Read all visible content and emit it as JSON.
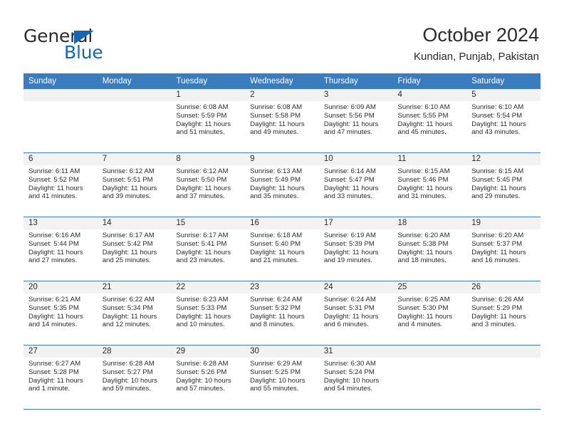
{
  "brand": {
    "name_top": "General",
    "name_bottom": "Blue"
  },
  "header": {
    "title": "October 2024",
    "subtitle": "Kundian, Punjab, Pakistan"
  },
  "weekday_headers": [
    "Sunday",
    "Monday",
    "Tuesday",
    "Wednesday",
    "Thursday",
    "Friday",
    "Saturday"
  ],
  "colors": {
    "header_blue": "#3b7cbe",
    "logo_blue": "#1565b0",
    "daynum_band": "#f2f2f2",
    "text": "#2b2b2b"
  },
  "labels": {
    "sunrise_prefix": "Sunrise: ",
    "sunset_prefix": "Sunset: ",
    "daylight_prefix": "Daylight: "
  },
  "weeks": [
    [
      {
        "day": "",
        "sunrise": "",
        "sunset": "",
        "daylight_line1": "",
        "daylight_line2": "",
        "blank": true
      },
      {
        "day": "",
        "sunrise": "",
        "sunset": "",
        "daylight_line1": "",
        "daylight_line2": "",
        "blank": true
      },
      {
        "day": "1",
        "sunrise": "Sunrise: 6:08 AM",
        "sunset": "Sunset: 5:59 PM",
        "daylight_line1": "Daylight: 11 hours",
        "daylight_line2": "and 51 minutes."
      },
      {
        "day": "2",
        "sunrise": "Sunrise: 6:08 AM",
        "sunset": "Sunset: 5:58 PM",
        "daylight_line1": "Daylight: 11 hours",
        "daylight_line2": "and 49 minutes."
      },
      {
        "day": "3",
        "sunrise": "Sunrise: 6:09 AM",
        "sunset": "Sunset: 5:56 PM",
        "daylight_line1": "Daylight: 11 hours",
        "daylight_line2": "and 47 minutes."
      },
      {
        "day": "4",
        "sunrise": "Sunrise: 6:10 AM",
        "sunset": "Sunset: 5:55 PM",
        "daylight_line1": "Daylight: 11 hours",
        "daylight_line2": "and 45 minutes."
      },
      {
        "day": "5",
        "sunrise": "Sunrise: 6:10 AM",
        "sunset": "Sunset: 5:54 PM",
        "daylight_line1": "Daylight: 11 hours",
        "daylight_line2": "and 43 minutes."
      }
    ],
    [
      {
        "day": "6",
        "sunrise": "Sunrise: 6:11 AM",
        "sunset": "Sunset: 5:52 PM",
        "daylight_line1": "Daylight: 11 hours",
        "daylight_line2": "and 41 minutes."
      },
      {
        "day": "7",
        "sunrise": "Sunrise: 6:12 AM",
        "sunset": "Sunset: 5:51 PM",
        "daylight_line1": "Daylight: 11 hours",
        "daylight_line2": "and 39 minutes."
      },
      {
        "day": "8",
        "sunrise": "Sunrise: 6:12 AM",
        "sunset": "Sunset: 5:50 PM",
        "daylight_line1": "Daylight: 11 hours",
        "daylight_line2": "and 37 minutes."
      },
      {
        "day": "9",
        "sunrise": "Sunrise: 6:13 AM",
        "sunset": "Sunset: 5:49 PM",
        "daylight_line1": "Daylight: 11 hours",
        "daylight_line2": "and 35 minutes."
      },
      {
        "day": "10",
        "sunrise": "Sunrise: 6:14 AM",
        "sunset": "Sunset: 5:47 PM",
        "daylight_line1": "Daylight: 11 hours",
        "daylight_line2": "and 33 minutes."
      },
      {
        "day": "11",
        "sunrise": "Sunrise: 6:15 AM",
        "sunset": "Sunset: 5:46 PM",
        "daylight_line1": "Daylight: 11 hours",
        "daylight_line2": "and 31 minutes."
      },
      {
        "day": "12",
        "sunrise": "Sunrise: 6:15 AM",
        "sunset": "Sunset: 5:45 PM",
        "daylight_line1": "Daylight: 11 hours",
        "daylight_line2": "and 29 minutes."
      }
    ],
    [
      {
        "day": "13",
        "sunrise": "Sunrise: 6:16 AM",
        "sunset": "Sunset: 5:44 PM",
        "daylight_line1": "Daylight: 11 hours",
        "daylight_line2": "and 27 minutes."
      },
      {
        "day": "14",
        "sunrise": "Sunrise: 6:17 AM",
        "sunset": "Sunset: 5:42 PM",
        "daylight_line1": "Daylight: 11 hours",
        "daylight_line2": "and 25 minutes."
      },
      {
        "day": "15",
        "sunrise": "Sunrise: 6:17 AM",
        "sunset": "Sunset: 5:41 PM",
        "daylight_line1": "Daylight: 11 hours",
        "daylight_line2": "and 23 minutes."
      },
      {
        "day": "16",
        "sunrise": "Sunrise: 6:18 AM",
        "sunset": "Sunset: 5:40 PM",
        "daylight_line1": "Daylight: 11 hours",
        "daylight_line2": "and 21 minutes."
      },
      {
        "day": "17",
        "sunrise": "Sunrise: 6:19 AM",
        "sunset": "Sunset: 5:39 PM",
        "daylight_line1": "Daylight: 11 hours",
        "daylight_line2": "and 19 minutes."
      },
      {
        "day": "18",
        "sunrise": "Sunrise: 6:20 AM",
        "sunset": "Sunset: 5:38 PM",
        "daylight_line1": "Daylight: 11 hours",
        "daylight_line2": "and 18 minutes."
      },
      {
        "day": "19",
        "sunrise": "Sunrise: 6:20 AM",
        "sunset": "Sunset: 5:37 PM",
        "daylight_line1": "Daylight: 11 hours",
        "daylight_line2": "and 16 minutes."
      }
    ],
    [
      {
        "day": "20",
        "sunrise": "Sunrise: 6:21 AM",
        "sunset": "Sunset: 5:35 PM",
        "daylight_line1": "Daylight: 11 hours",
        "daylight_line2": "and 14 minutes."
      },
      {
        "day": "21",
        "sunrise": "Sunrise: 6:22 AM",
        "sunset": "Sunset: 5:34 PM",
        "daylight_line1": "Daylight: 11 hours",
        "daylight_line2": "and 12 minutes."
      },
      {
        "day": "22",
        "sunrise": "Sunrise: 6:23 AM",
        "sunset": "Sunset: 5:33 PM",
        "daylight_line1": "Daylight: 11 hours",
        "daylight_line2": "and 10 minutes."
      },
      {
        "day": "23",
        "sunrise": "Sunrise: 6:24 AM",
        "sunset": "Sunset: 5:32 PM",
        "daylight_line1": "Daylight: 11 hours",
        "daylight_line2": "and 8 minutes."
      },
      {
        "day": "24",
        "sunrise": "Sunrise: 6:24 AM",
        "sunset": "Sunset: 5:31 PM",
        "daylight_line1": "Daylight: 11 hours",
        "daylight_line2": "and 6 minutes."
      },
      {
        "day": "25",
        "sunrise": "Sunrise: 6:25 AM",
        "sunset": "Sunset: 5:30 PM",
        "daylight_line1": "Daylight: 11 hours",
        "daylight_line2": "and 4 minutes."
      },
      {
        "day": "26",
        "sunrise": "Sunrise: 6:26 AM",
        "sunset": "Sunset: 5:29 PM",
        "daylight_line1": "Daylight: 11 hours",
        "daylight_line2": "and 3 minutes."
      }
    ],
    [
      {
        "day": "27",
        "sunrise": "Sunrise: 6:27 AM",
        "sunset": "Sunset: 5:28 PM",
        "daylight_line1": "Daylight: 11 hours",
        "daylight_line2": "and 1 minute."
      },
      {
        "day": "28",
        "sunrise": "Sunrise: 6:28 AM",
        "sunset": "Sunset: 5:27 PM",
        "daylight_line1": "Daylight: 10 hours",
        "daylight_line2": "and 59 minutes."
      },
      {
        "day": "29",
        "sunrise": "Sunrise: 6:28 AM",
        "sunset": "Sunset: 5:26 PM",
        "daylight_line1": "Daylight: 10 hours",
        "daylight_line2": "and 57 minutes."
      },
      {
        "day": "30",
        "sunrise": "Sunrise: 6:29 AM",
        "sunset": "Sunset: 5:25 PM",
        "daylight_line1": "Daylight: 10 hours",
        "daylight_line2": "and 55 minutes."
      },
      {
        "day": "31",
        "sunrise": "Sunrise: 6:30 AM",
        "sunset": "Sunset: 5:24 PM",
        "daylight_line1": "Daylight: 10 hours",
        "daylight_line2": "and 54 minutes."
      },
      {
        "day": "",
        "sunrise": "",
        "sunset": "",
        "daylight_line1": "",
        "daylight_line2": "",
        "blank": true
      },
      {
        "day": "",
        "sunrise": "",
        "sunset": "",
        "daylight_line1": "",
        "daylight_line2": "",
        "blank": true
      }
    ]
  ]
}
